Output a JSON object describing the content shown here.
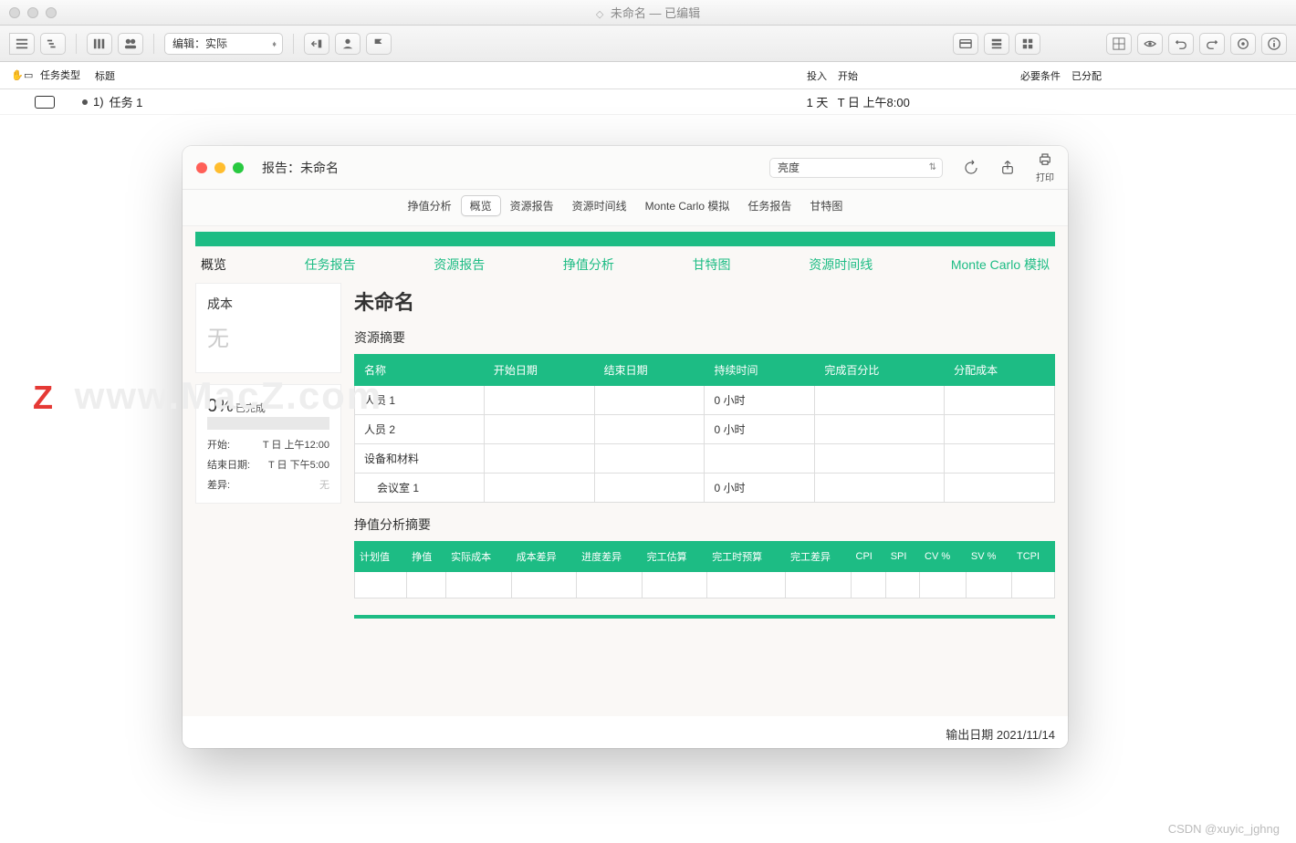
{
  "main": {
    "title": "未命名 — 已编辑",
    "editModeLabel": "编辑：实际"
  },
  "taskTable": {
    "cols": {
      "type": "任务类型",
      "title": "标题",
      "effort": "投入",
      "start": "开始",
      "prereq": "必要条件",
      "assigned": "已分配"
    },
    "row1": {
      "idx": "1)",
      "name": "任务 1",
      "effort": "1 天",
      "start": "T 日 上午8:00"
    }
  },
  "report": {
    "winTitle": "报告：未命名",
    "brightness": "亮度",
    "printLabel": "打印",
    "segments": [
      "挣值分析",
      "概览",
      "资源报告",
      "资源时间线",
      "Monte Carlo 模拟",
      "任务报告",
      "甘特图"
    ],
    "segActive": "概览",
    "navTabs": [
      "概览",
      "任务报告",
      "资源报告",
      "挣值分析",
      "甘特图",
      "资源时间线",
      "Monte Carlo 模拟"
    ],
    "navActive": "概览"
  },
  "sidebar": {
    "costTitle": "成本",
    "costValue": "无",
    "percent": "0%",
    "percentSuffix": "已完成",
    "startLabel": "开始:",
    "startValue": "T 日 上午12:00",
    "endLabel": "结束日期:",
    "endValue": "T 日 下午5:00",
    "varianceLabel": "差异:",
    "varianceValue": "无"
  },
  "content": {
    "projectName": "未命名",
    "resourceSummaryTitle": "资源摘要",
    "resourceHeaders": [
      "名称",
      "开始日期",
      "结束日期",
      "持续时间",
      "完成百分比",
      "分配成本"
    ],
    "resourceRows": [
      {
        "name": "人员 1",
        "start": "",
        "end": "",
        "duration": "0 小时",
        "pct": "",
        "cost": ""
      },
      {
        "name": "人员 2",
        "start": "",
        "end": "",
        "duration": "0 小时",
        "pct": "",
        "cost": ""
      },
      {
        "name": "设备和材料",
        "start": "",
        "end": "",
        "duration": "",
        "pct": "",
        "cost": ""
      },
      {
        "name": "会议室 1",
        "start": "",
        "end": "",
        "duration": "0 小时",
        "pct": "",
        "cost": "",
        "indent": true
      }
    ],
    "evTitle": "挣值分析摘要",
    "evHeaders": [
      "计划值",
      "挣值",
      "实际成本",
      "成本差异",
      "进度差异",
      "完工估算",
      "完工时预算",
      "完工差异",
      "CPI",
      "SPI",
      "CV %",
      "SV %",
      "TCPI"
    ],
    "pubDateLabel": "输出日期",
    "pubDate": "2021/11/14"
  },
  "watermark": "www.MacZ.com",
  "credit": "CSDN @xuyic_jghng"
}
